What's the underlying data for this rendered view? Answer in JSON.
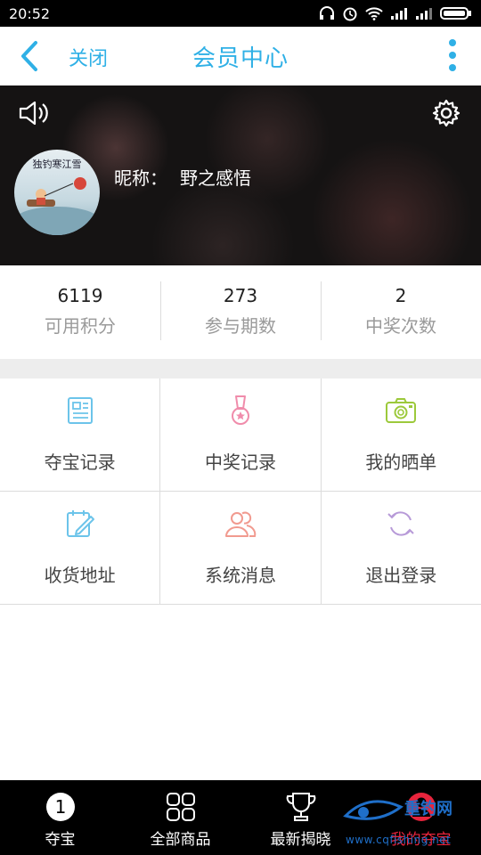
{
  "status_bar": {
    "time": "20:52"
  },
  "nav": {
    "close_label": "关闭",
    "title": "会员中心"
  },
  "profile": {
    "nickname_label": "昵称：",
    "nickname": "野之感悟",
    "avatar_text": "独钓寒江雪"
  },
  "stats": [
    {
      "value": "6119",
      "label": "可用积分"
    },
    {
      "value": "273",
      "label": "参与期数"
    },
    {
      "value": "2",
      "label": "中奖次数"
    }
  ],
  "menu": [
    {
      "label": "夺宝记录",
      "icon": "record-icon",
      "color": "#6cc4ea"
    },
    {
      "label": "中奖记录",
      "icon": "medal-icon",
      "color": "#f08cab"
    },
    {
      "label": "我的晒单",
      "icon": "camera-icon",
      "color": "#9cc93b"
    },
    {
      "label": "收货地址",
      "icon": "address-edit-icon",
      "color": "#6cc4ea"
    },
    {
      "label": "系统消息",
      "icon": "users-icon",
      "color": "#f19a8f"
    },
    {
      "label": "退出登录",
      "icon": "refresh-icon",
      "color": "#b79ad8"
    }
  ],
  "tabs": [
    {
      "label": "夺宝",
      "icon": "badge-one-icon",
      "badge": "1"
    },
    {
      "label": "全部商品",
      "icon": "grid-icon"
    },
    {
      "label": "最新揭晓",
      "icon": "trophy-icon"
    },
    {
      "label": "我的夺宝",
      "icon": "user-icon",
      "active": true
    }
  ],
  "watermark": {
    "brand": "重钓网",
    "url": "www.cqfishing.net"
  },
  "colors": {
    "accent": "#2fb0e6",
    "tab_active": "#e8243c"
  }
}
